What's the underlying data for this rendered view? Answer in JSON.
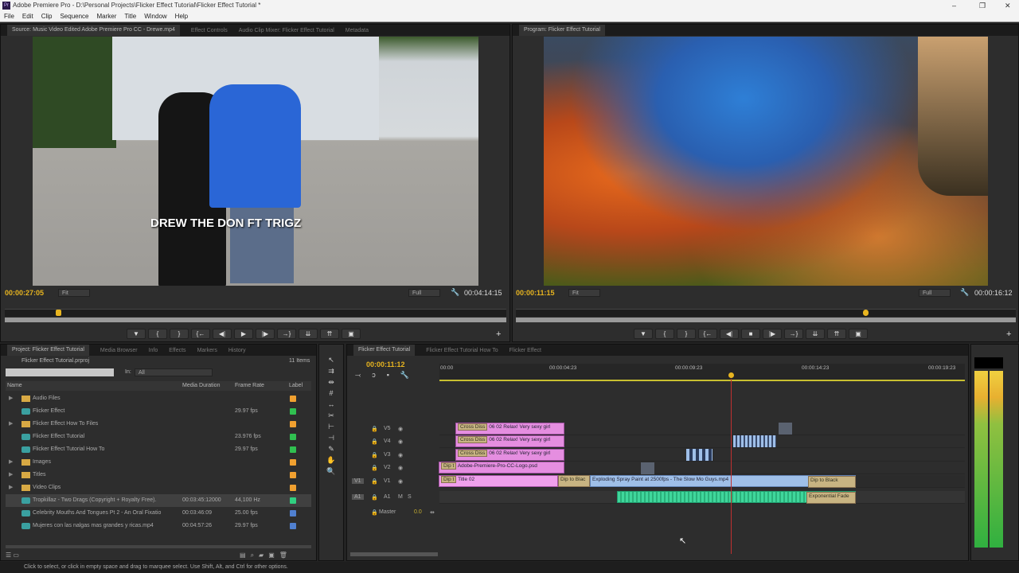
{
  "titlebar": {
    "title": "Adobe Premiere Pro - D:\\Personal Projects\\Flicker Effect Tutorial\\Flicker Effect Tutorial *",
    "logo": "Pr",
    "minimize": "–",
    "maximize": "❐",
    "close": "✕"
  },
  "menu": [
    "File",
    "Edit",
    "Clip",
    "Sequence",
    "Marker",
    "Title",
    "Window",
    "Help"
  ],
  "source_panel": {
    "tabs": [
      "Source: Music Video Edited Adobe Premiere Pro CC - Drewe.mp4",
      "Effect Controls",
      "Audio Clip Mixer: Flicker Effect Tutorial",
      "Metadata"
    ],
    "overlay_text": "DREW THE DON FT TRIGZ",
    "timecode": "00:00:27:05",
    "zoom": "Fit",
    "resolution": "Full",
    "duration": "00:04:14:15"
  },
  "program_panel": {
    "tabs": [
      "Program: Flicker Effect Tutorial"
    ],
    "timecode": "00:00:11:15",
    "zoom": "Fit",
    "resolution": "Full",
    "duration": "00:00:16:12"
  },
  "transport": {
    "marker": "▼",
    "mark_in": "{",
    "mark_out": "}",
    "go_in": "{←",
    "step_back": "◀|",
    "play": "▶",
    "stop": "■",
    "step_fwd": "|▶",
    "go_out": "→}",
    "insert": "⇊",
    "overwrite": "⇈",
    "export": "▣",
    "add": "+"
  },
  "project_panel": {
    "tabs": [
      "Project: Flicker Effect Tutorial",
      "Media Browser",
      "Info",
      "Effects",
      "Markers",
      "History"
    ],
    "project_file": "Flicker Effect Tutorial.prproj",
    "item_count": "11 Items",
    "search_value": "",
    "in_label": "In:",
    "in_value": "All",
    "columns": {
      "name": "Name",
      "duration": "Media Duration",
      "frame_rate": "Frame Rate",
      "label": "Label"
    },
    "items": [
      {
        "name": "Audio Files",
        "type": "folder",
        "duration": "",
        "frame_rate": "",
        "label_color": "#f0a030"
      },
      {
        "name": "Flicker Effect",
        "type": "sequence",
        "duration": "",
        "frame_rate": "29.97 fps",
        "label_color": "#30c050"
      },
      {
        "name": "Flicker Effect How To Files",
        "type": "folder",
        "duration": "",
        "frame_rate": "",
        "label_color": "#f0a030"
      },
      {
        "name": "Flicker Effect Tutorial",
        "type": "sequence",
        "duration": "",
        "frame_rate": "23.976 fps",
        "label_color": "#30c050"
      },
      {
        "name": "Flicker Effect Tutorial How To",
        "type": "sequence",
        "duration": "",
        "frame_rate": "29.97 fps",
        "label_color": "#30c050"
      },
      {
        "name": "Images",
        "type": "folder",
        "duration": "",
        "frame_rate": "",
        "label_color": "#f0a030"
      },
      {
        "name": "Titles",
        "type": "folder",
        "duration": "",
        "frame_rate": "",
        "label_color": "#f0a030"
      },
      {
        "name": "Video Clips",
        "type": "folder",
        "duration": "",
        "frame_rate": "",
        "label_color": "#f0a030"
      },
      {
        "name": "Tropkillaz - Two Drags (Copyright + Royalty Free).",
        "type": "audio",
        "duration": "00:03:45:12000",
        "frame_rate": "44,100 Hz",
        "label_color": "#30d080"
      },
      {
        "name": "Celebrity Mouths And Tongues Pt 2 - An Oral Fixatio",
        "type": "video",
        "duration": "00:03:46:09",
        "frame_rate": "25.00 fps",
        "label_color": "#5080d0"
      },
      {
        "name": "Mujeres con las nalgas mas grandes y ricas.mp4",
        "type": "video",
        "duration": "00:04:57:26",
        "frame_rate": "29.97 fps",
        "label_color": "#5080d0"
      }
    ]
  },
  "timeline": {
    "tabs": [
      "Flicker Effect Tutorial",
      "Flicker Effect Tutorial How To",
      "Flicker Effect"
    ],
    "timecode": "00:00:11:12",
    "ruler": [
      "00:00",
      "00:00:04:23",
      "00:00:09:23",
      "00:00:14:23",
      "00:00:19:23"
    ],
    "tracks": [
      {
        "name": "V5"
      },
      {
        "name": "V4"
      },
      {
        "name": "V3"
      },
      {
        "name": "V2"
      },
      {
        "name": "V1",
        "source": "V1"
      },
      {
        "name": "A1",
        "source": "A1"
      },
      {
        "name": "Master",
        "value": "0.0"
      }
    ],
    "clips": {
      "cross": "Cross Diss",
      "relax": "06 02 Relax! Very sexy girl",
      "dip": "Dip t",
      "logo": "Adobe-Premiere-Pro-CC-Logo.psd",
      "title": "Title 02",
      "dip_black_short": "Dip to Blac",
      "spray": "Exploding Spray Paint at 2500fps - The Slow Mo Guys.mp4",
      "dip_black": "Dip to Black",
      "exp_fade": "Exponential Fade"
    }
  },
  "status": "Click to select, or click in empty space and drag to marquee select. Use Shift, Alt, and Ctrl for other options."
}
